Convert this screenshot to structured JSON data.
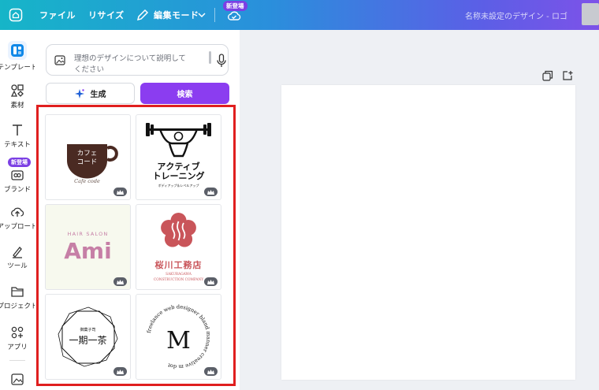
{
  "topbar": {
    "file_label": "ファイル",
    "resize_label": "リサイズ",
    "edit_mode_label": "編集モード",
    "new_badge": "新登場",
    "doc_title": "名称未設定のデザイン - ロゴ"
  },
  "rail": {
    "items": [
      {
        "label": "テンプレート",
        "icon": "template-icon"
      },
      {
        "label": "素材",
        "icon": "elements-icon"
      },
      {
        "label": "テキスト",
        "icon": "text-icon"
      },
      {
        "label": "ブランド",
        "icon": "brand-icon"
      },
      {
        "label": "アップロード",
        "icon": "upload-icon"
      },
      {
        "label": "ツール",
        "icon": "tools-icon"
      },
      {
        "label": "プロジェクト",
        "icon": "folder-icon"
      },
      {
        "label": "アプリ",
        "icon": "apps-icon"
      }
    ],
    "new_badge": "新登場"
  },
  "panel": {
    "search_placeholder": "理想のデザインについて説明してください",
    "generate_label": "生成",
    "search_button_label": "検索"
  },
  "templates": [
    {
      "text1": "カフェ",
      "text2": "コード",
      "text3": "Cafe code"
    },
    {
      "text1": "アクティブ",
      "text2": "トレーニング",
      "text3": "ボディアップ＆レベルアップ"
    },
    {
      "text1": "HAIR SALON",
      "text2": "Ami"
    },
    {
      "text1": "桜川工務店",
      "text2": "SAKURAGAWA",
      "text3": "CONSTRUCTION COMPANY"
    },
    {
      "text1": "御菓子司",
      "text2": "一期一茶"
    },
    {
      "text1": "freelance web designer bland manner creative m dot",
      "text2": "M"
    }
  ],
  "colors": {
    "accent_purple": "#8b3df0",
    "highlight_red": "#e01f1f",
    "coffee_brown": "#4a2a22",
    "ami_pink": "#c67fa6",
    "sakura_red": "#c9555a"
  }
}
